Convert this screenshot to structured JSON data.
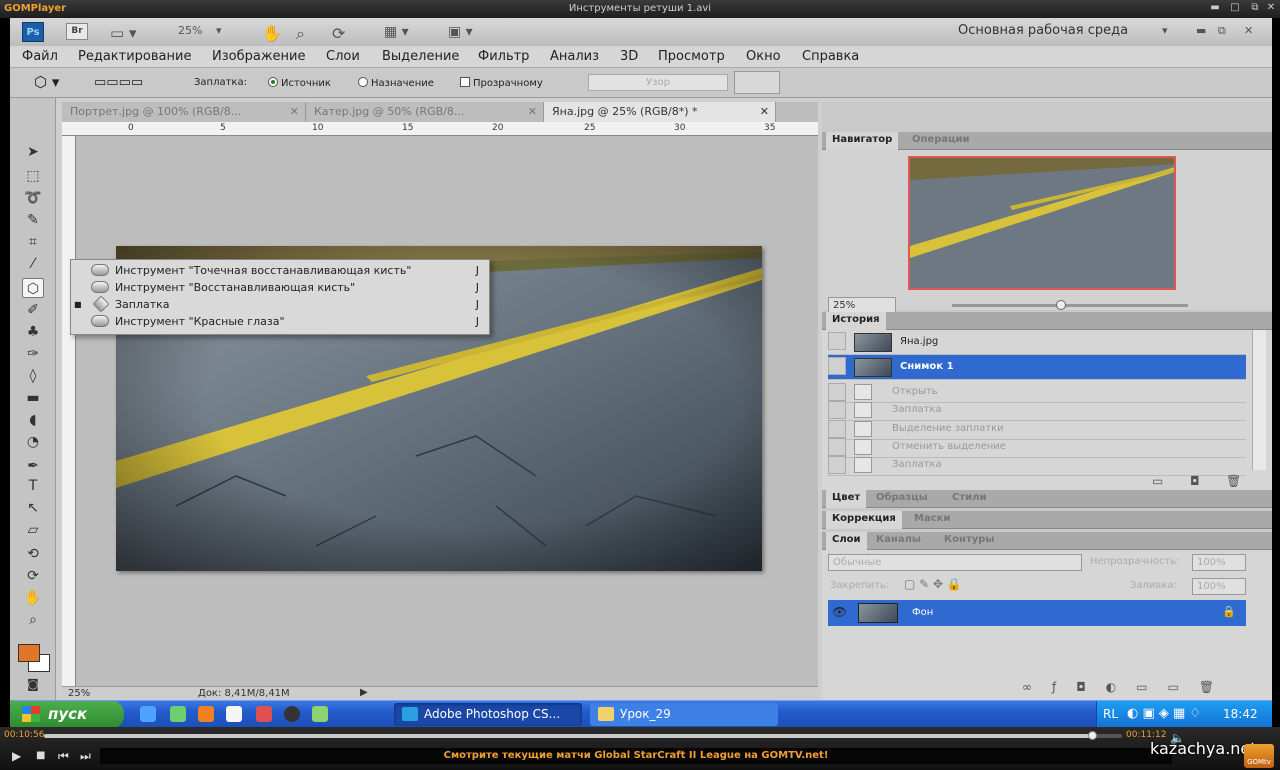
{
  "player": {
    "logo": "GOMPlayer",
    "title": "Инструменты ретуши 1.avi",
    "time_current": "00:10:56",
    "time_total": "00:11:12",
    "progress": 0.972,
    "ticker": "Смотрите текущие матчи Global StarCraft II League на GOMTV.net!",
    "watermark": "kazachya.net",
    "gom_badge": "GOMtv",
    "buttons": [
      "play",
      "stop",
      "previous",
      "next"
    ]
  },
  "photoshop": {
    "ps_badge": "Ps",
    "br_badge": "Br",
    "zoom_combo": "25%",
    "workspace": "Основная рабочая среда",
    "menu": [
      "Файл",
      "Редактирование",
      "Изображение",
      "Слои",
      "Выделение",
      "Фильтр",
      "Анализ",
      "3D",
      "Просмотр",
      "Окно",
      "Справка"
    ],
    "options": {
      "patch_label": "Заплатка:",
      "source": "Источник",
      "destination": "Назначение",
      "transparent": "Прозрачному",
      "pattern_button": "Узор"
    },
    "tabs": [
      {
        "label": "Портрет.jpg @ 100% (RGB/8...",
        "active": false
      },
      {
        "label": "Катер.jpg @ 50% (RGB/8...",
        "active": false
      },
      {
        "label": "Яна.jpg @ 25% (RGB/8*) *",
        "active": true
      }
    ],
    "ruler_labels": [
      "0",
      "5",
      "10",
      "15",
      "20",
      "25",
      "30",
      "35"
    ],
    "flyout": [
      {
        "label": "Инструмент \"Точечная восстанавливающая кисть\"",
        "key": "J",
        "selected": false
      },
      {
        "label": "Инструмент \"Восстанавливающая кисть\"",
        "key": "J",
        "selected": false
      },
      {
        "label": "Заплатка",
        "key": "J",
        "selected": true
      },
      {
        "label": "Инструмент \"Красные глаза\"",
        "key": "J",
        "selected": false
      }
    ],
    "status": {
      "zoom": "25%",
      "doc": "Док: 8,41M/8,41M"
    },
    "navigator": {
      "tab1": "Навигатор",
      "tab2": "Операции",
      "zoom": "25%"
    },
    "history": {
      "tab": "История",
      "snapshot": "Яна.jpg",
      "items": [
        {
          "label": "Снимок 1",
          "selected": true
        },
        {
          "label": "Открыть",
          "selected": false
        },
        {
          "label": "Заплатка",
          "selected": false
        },
        {
          "label": "Выделение заплатки",
          "selected": false
        },
        {
          "label": "Отменить выделение",
          "selected": false
        },
        {
          "label": "Заплатка",
          "selected": false
        }
      ]
    },
    "color_tabs": [
      "Цвет",
      "Образцы",
      "Стили"
    ],
    "adj_tabs": [
      "Коррекция",
      "Маски"
    ],
    "layer_tabs": [
      "Слои",
      "Каналы",
      "Контуры"
    ],
    "layers": {
      "blend": "Обычные",
      "opacity_label": "Непрозрачность:",
      "opacity": "100%",
      "lock_label": "Закрепить:",
      "fill_label": "Заливка:",
      "fill": "100%",
      "layer_name": "Фон"
    }
  },
  "taskbar": {
    "start": "пуск",
    "tasks": [
      "Adobe Photoshop CS...",
      "Урок_29"
    ],
    "lang": "RL",
    "clock": "18:42"
  },
  "colors": {
    "foreground": "#e07628",
    "selection": "#2f6ad0",
    "taskbar": "#245ccb"
  }
}
